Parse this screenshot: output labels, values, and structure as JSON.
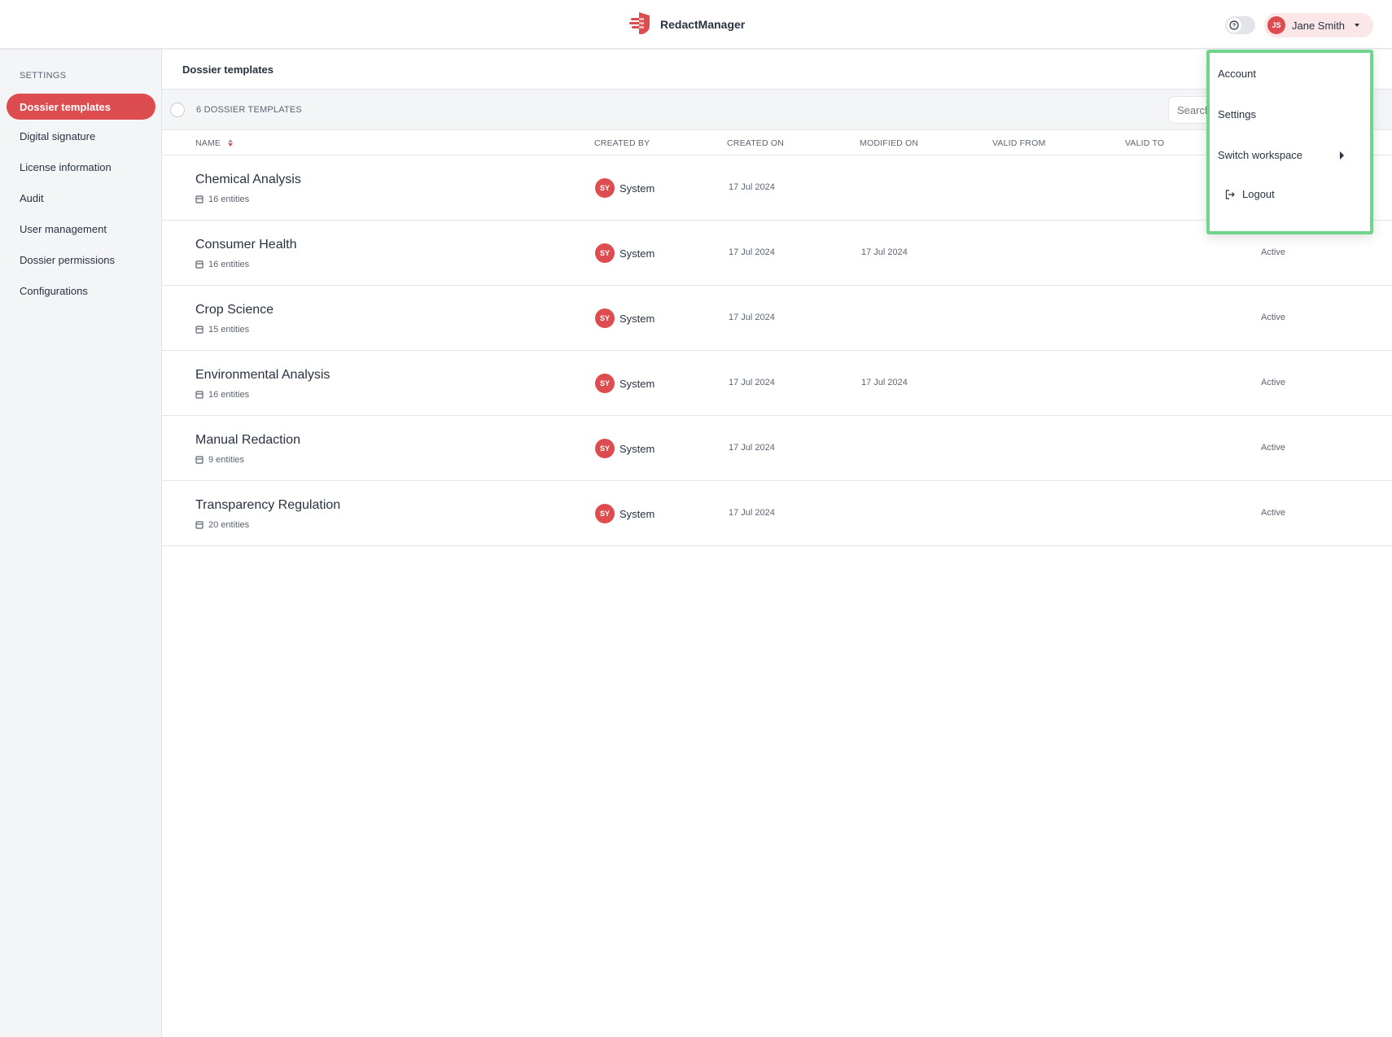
{
  "header": {
    "app_name": "RedactManager",
    "user": {
      "initials": "JS",
      "name": "Jane Smith"
    }
  },
  "sidebar": {
    "title": "SETTINGS",
    "items": [
      {
        "label": "Dossier templates",
        "active": true
      },
      {
        "label": "Digital signature"
      },
      {
        "label": "License information"
      },
      {
        "label": "Audit"
      },
      {
        "label": "User management"
      },
      {
        "label": "Dossier permissions"
      },
      {
        "label": "Configurations"
      }
    ]
  },
  "main": {
    "title": "Dossier templates",
    "count_label": "6 DOSSIER TEMPLATES",
    "search_placeholder": "Search...",
    "columns": {
      "name": "NAME",
      "created_by": "CREATED BY",
      "created_on": "CREATED ON",
      "modified_on": "MODIFIED ON",
      "valid_from": "VALID FROM",
      "valid_to": "VALID TO"
    },
    "rows": [
      {
        "name": "Chemical Analysis",
        "entities": "16 entities",
        "creator_initials": "SY",
        "creator": "System",
        "created_on": "17 Jul 2024",
        "modified_on": "",
        "status": ""
      },
      {
        "name": "Consumer Health",
        "entities": "16 entities",
        "creator_initials": "SY",
        "creator": "System",
        "created_on": "17 Jul 2024",
        "modified_on": "17 Jul 2024",
        "status": "Active"
      },
      {
        "name": "Crop Science",
        "entities": "15 entities",
        "creator_initials": "SY",
        "creator": "System",
        "created_on": "17 Jul 2024",
        "modified_on": "",
        "status": "Active"
      },
      {
        "name": "Environmental Analysis",
        "entities": "16 entities",
        "creator_initials": "SY",
        "creator": "System",
        "created_on": "17 Jul 2024",
        "modified_on": "17 Jul 2024",
        "status": "Active"
      },
      {
        "name": "Manual Redaction",
        "entities": "9 entities",
        "creator_initials": "SY",
        "creator": "System",
        "created_on": "17 Jul 2024",
        "modified_on": "",
        "status": "Active"
      },
      {
        "name": "Transparency Regulation",
        "entities": "20 entities",
        "creator_initials": "SY",
        "creator": "System",
        "created_on": "17 Jul 2024",
        "modified_on": "",
        "status": "Active"
      }
    ]
  },
  "user_menu": {
    "account": "Account",
    "settings": "Settings",
    "switch_workspace": "Switch workspace",
    "logout": "Logout"
  },
  "colors": {
    "accent": "#dd4d50",
    "menu_highlight": "#6fd58a",
    "sidebar_bg": "#f4f5f7"
  }
}
